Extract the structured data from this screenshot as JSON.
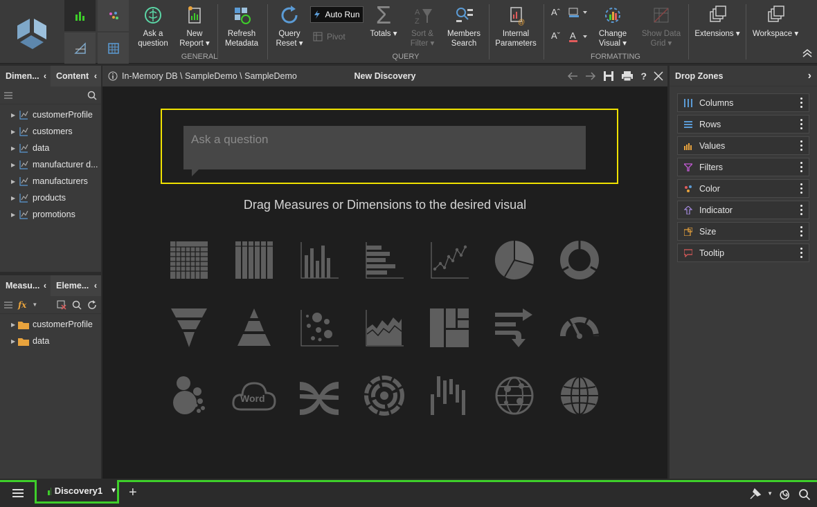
{
  "ribbon": {
    "general": {
      "label": "GENERAL",
      "ask": [
        "Ask a",
        "question"
      ],
      "new_report": [
        "New",
        "Report ▾"
      ],
      "refresh": [
        "Refresh",
        "Metadata"
      ]
    },
    "query": {
      "label": "QUERY",
      "query_reset": [
        "Query",
        "Reset ▾"
      ],
      "auto_run": "Auto Run",
      "pivot": "Pivot",
      "totals": "Totals ▾",
      "sort_filter": [
        "Sort &",
        "Filter ▾"
      ],
      "members_search": [
        "Members",
        "Search"
      ],
      "internal_params": [
        "Internal",
        "Parameters"
      ]
    },
    "formatting": {
      "label": "FORMATTING",
      "change_visual": [
        "Change",
        "Visual ▾"
      ],
      "show_data_grid": [
        "Show Data",
        "Grid ▾"
      ]
    },
    "extensions": "Extensions ▾",
    "workspace": "Workspace ▾"
  },
  "left_top": {
    "tabs": [
      "Dimen...",
      "Content"
    ],
    "items": [
      "customerProfile",
      "customers",
      "data",
      "manufacturer d...",
      "manufacturers",
      "products",
      "promotions"
    ]
  },
  "left_bottom": {
    "tabs": [
      "Measu...",
      "Eleme..."
    ],
    "items": [
      "customerProfile",
      "data"
    ]
  },
  "center": {
    "breadcrumb": "In-Memory DB \\ SampleDemo \\ SampleDemo",
    "title": "New Discovery",
    "ask_placeholder": "Ask a question",
    "drag_hint": "Drag Measures or Dimensions to the desired visual",
    "word_label": "Word"
  },
  "drop_zones": {
    "title": "Drop Zones",
    "items": [
      "Columns",
      "Rows",
      "Values",
      "Filters",
      "Color",
      "Indicator",
      "Size",
      "Tooltip"
    ],
    "colors": [
      "#5b9bd5",
      "#5b9bd5",
      "#e8a33d",
      "#c45bd6",
      "#e05b5b",
      "#a58be0",
      "#e8a33d",
      "#e05b5b"
    ]
  },
  "bottom": {
    "tab_label": "Discovery1"
  },
  "colors": {
    "accent_green": "#3ecf2a",
    "highlight": "#f0e200"
  }
}
